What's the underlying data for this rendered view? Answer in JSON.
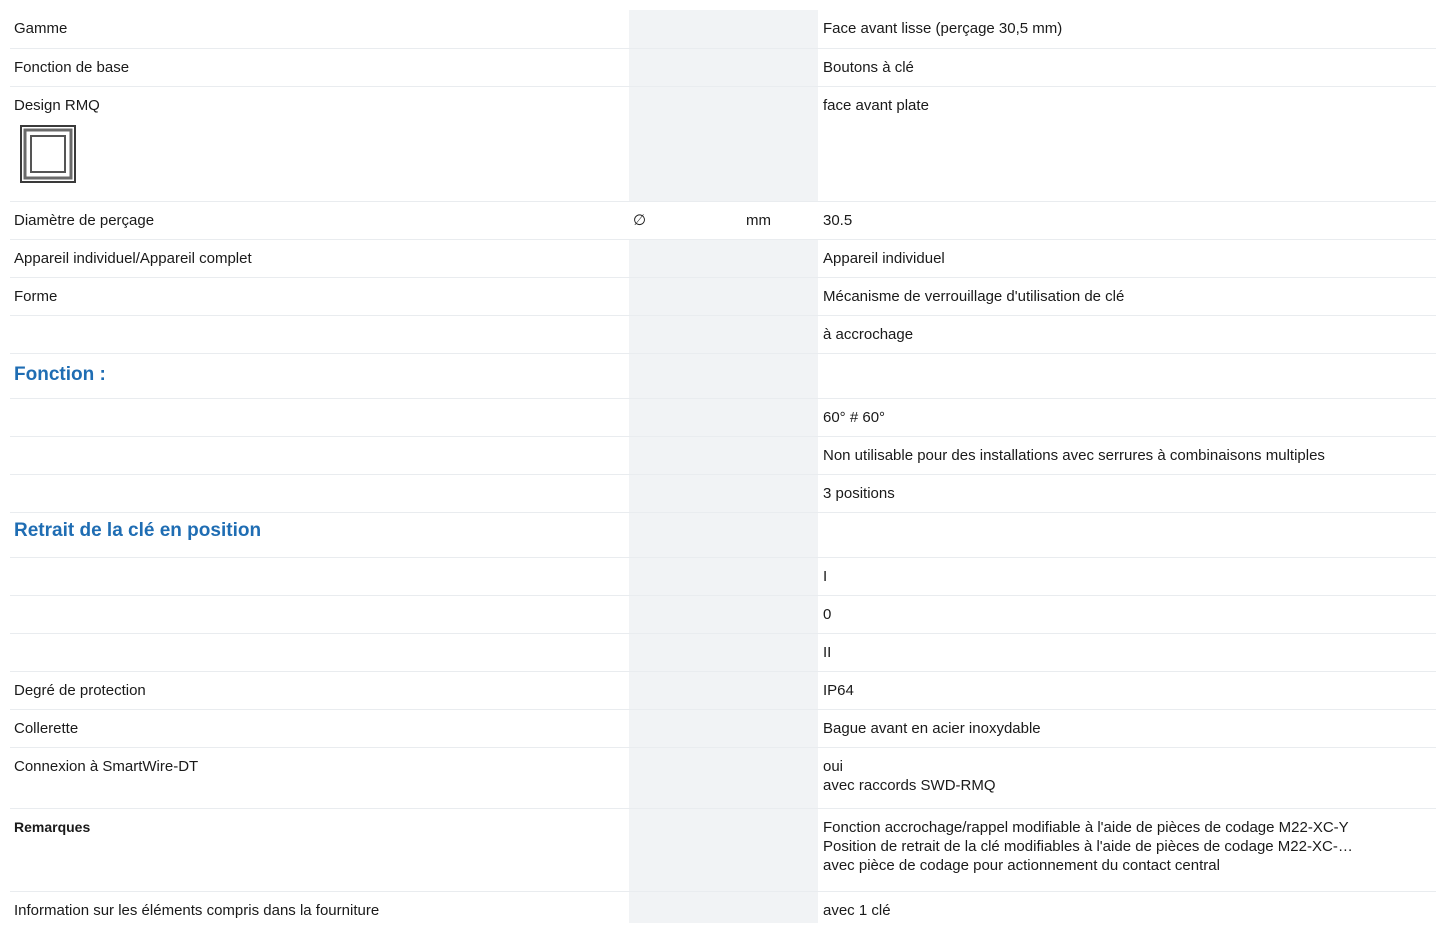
{
  "rows": [
    {
      "label": "Gamme",
      "symbol": "",
      "unit": "",
      "value": "Face avant lisse (perçage 30,5 mm)"
    },
    {
      "label": "Fonction de base",
      "symbol": "",
      "unit": "",
      "value": "Boutons à clé"
    },
    {
      "label": "Design RMQ",
      "symbol": "",
      "unit": "",
      "value": "face avant plate",
      "icon": "flat-front-square-icon"
    },
    {
      "label": "Diamètre de perçage",
      "symbol": "∅",
      "unit": "mm",
      "value": "30.5"
    },
    {
      "label": "Appareil individuel/Appareil complet",
      "symbol": "",
      "unit": "",
      "value": "Appareil individuel"
    },
    {
      "label": "Forme",
      "symbol": "",
      "unit": "",
      "value": "Mécanisme de verrouillage d'utilisation de clé"
    },
    {
      "label": "",
      "symbol": "",
      "unit": "",
      "value": "à accrochage"
    }
  ],
  "section_fonction": {
    "title": "Fonction :",
    "values": [
      "60° # 60°",
      "Non utilisable pour des installations avec serrures à combinaisons multiples",
      "3 positions"
    ]
  },
  "section_retrait": {
    "title": "Retrait de la clé en position",
    "values": [
      "I",
      "0",
      "II"
    ]
  },
  "rows_after": [
    {
      "label": "Degré de protection",
      "value": "IP64"
    },
    {
      "label": "Collerette",
      "value": "Bague avant en acier inoxydable"
    }
  ],
  "smartwire": {
    "label": "Connexion à SmartWire-DT",
    "lines": [
      "oui",
      "avec raccords SWD-RMQ"
    ]
  },
  "remarques": {
    "label": "Remarques",
    "lines": [
      "Fonction accrochage/rappel modifiable à l'aide de pièces de codage M22-XC-Y",
      "Position de retrait de la clé modifiables à l'aide de pièces de codage M22-XC-…",
      "avec pièce de codage pour actionnement du contact central"
    ]
  },
  "fourniture": {
    "label": "Information sur les éléments compris dans la fourniture",
    "value": "avec 1 clé"
  },
  "colors": {
    "section_title": "#1f6db3",
    "shaded_column": "#f1f3f5",
    "row_divider": "#e9ecef"
  }
}
